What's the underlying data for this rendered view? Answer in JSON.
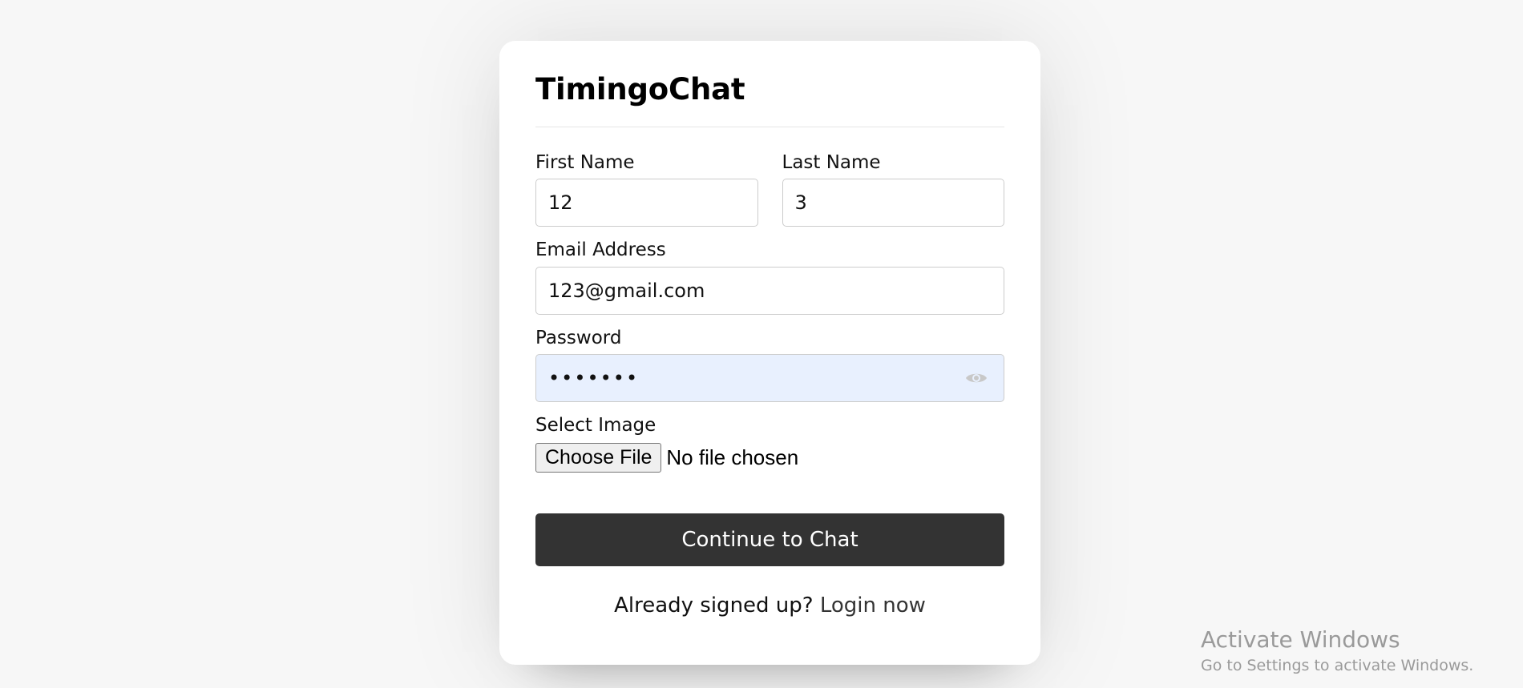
{
  "app": {
    "title": "TimingoChat"
  },
  "form": {
    "first_name": {
      "label": "First Name",
      "value": "12"
    },
    "last_name": {
      "label": "Last Name",
      "value": "3"
    },
    "email": {
      "label": "Email Address",
      "value": "123@gmail.com"
    },
    "password": {
      "label": "Password",
      "value": "•••••••",
      "icon": "eye-icon"
    },
    "image": {
      "label": "Select Image",
      "button_label": "Choose File",
      "status": "No file chosen"
    },
    "submit_label": "Continue to Chat",
    "login_prompt": "Already signed up?",
    "login_link": "Login now"
  },
  "watermark": {
    "title": "Activate Windows",
    "subtitle": "Go to Settings to activate Windows."
  },
  "colors": {
    "page_background": "#f7f7f7",
    "card_background": "#ffffff",
    "button_background": "#333333",
    "password_field_background": "#e8f0fe"
  }
}
